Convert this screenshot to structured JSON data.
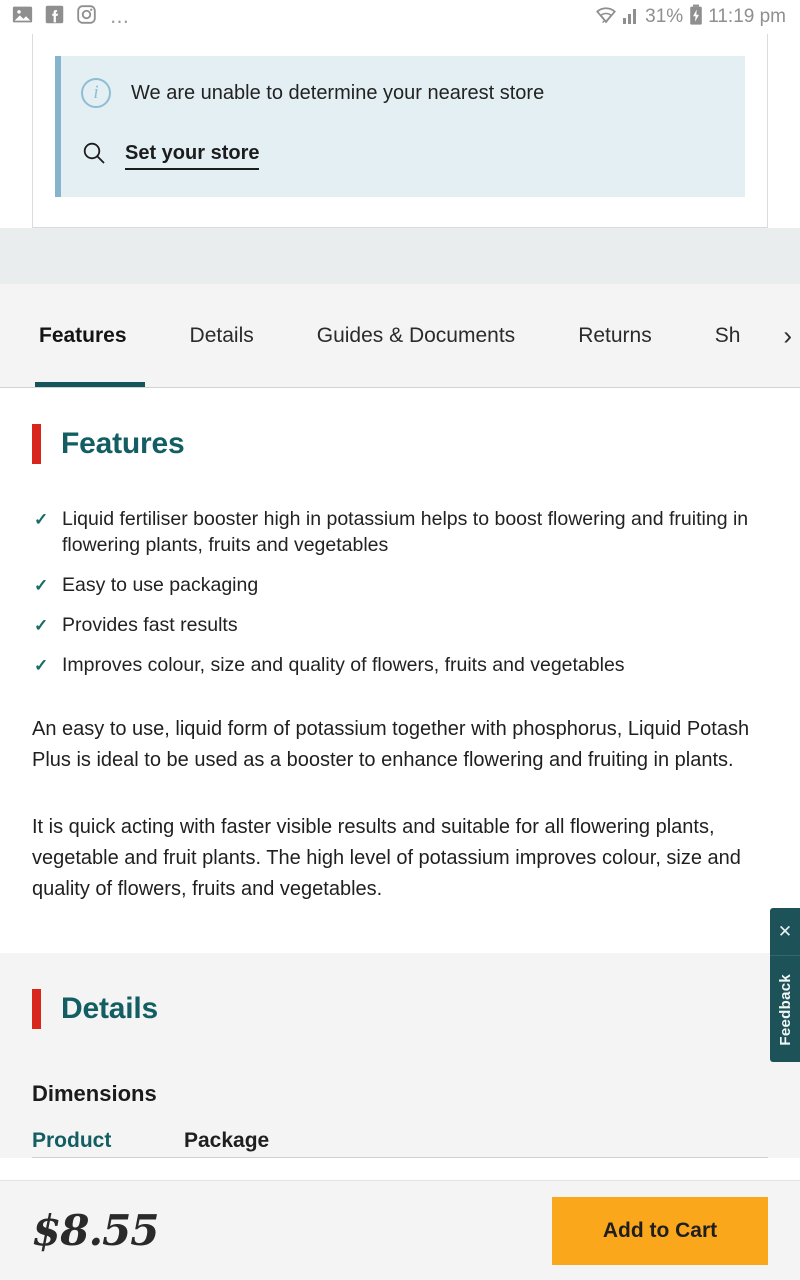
{
  "statusbar": {
    "icons": [
      "image-icon",
      "facebook-icon",
      "instagram-icon",
      "overflow-dots-icon"
    ],
    "dots": "…",
    "battery_percent": "31%",
    "time": "11:19 pm",
    "wifi_icon": "wifi-icon",
    "signal_icon": "cellular-signal-icon",
    "battery_icon": "battery-charging-icon"
  },
  "store_card": {
    "info_icon": "info-circle-icon",
    "message": "We are unable to determine your nearest store",
    "search_icon": "search-icon",
    "link_label": "Set your store"
  },
  "tabs": {
    "items": [
      {
        "label": "Features",
        "active": true
      },
      {
        "label": "Details",
        "active": false
      },
      {
        "label": "Guides & Documents",
        "active": false
      },
      {
        "label": "Returns",
        "active": false
      },
      {
        "label": "Sh",
        "active": false
      }
    ],
    "scroll_chevron": "›"
  },
  "features": {
    "heading": "Features",
    "tick_glyph": "✓",
    "bullets": [
      "Liquid fertiliser booster high in potassium helps to boost flowering and fruiting in flowering plants, fruits and vegetables",
      "Easy to use packaging",
      "Provides fast results",
      "Improves colour, size and quality of flowers, fruits and vegetables"
    ],
    "paragraph1": "An easy to use, liquid form of potassium together with phosphorus, Liquid Potash Plus is ideal to be used as a booster to enhance flowering and fruiting in plants.",
    "paragraph2": "It is quick acting with faster visible results and suitable for all flowering plants, vegetable and fruit plants. The high level of potassium improves colour, size and quality of flowers, fruits and vegetables."
  },
  "details": {
    "heading": "Details",
    "dimensions_title": "Dimensions",
    "dimension_tabs": [
      {
        "label": "Product",
        "active": true
      },
      {
        "label": "Package",
        "active": false
      }
    ]
  },
  "feedback": {
    "close_glyph": "✕",
    "label": "Feedback"
  },
  "bottombar": {
    "price": "$8.55",
    "add_to_cart_label": "Add to Cart"
  },
  "colors": {
    "teal": "#125e63",
    "teal_dark": "#1d5259",
    "red_accent": "#d9261c",
    "orange": "#faa71b",
    "info_bg": "#e4eff4",
    "info_border": "#84b5cc"
  }
}
